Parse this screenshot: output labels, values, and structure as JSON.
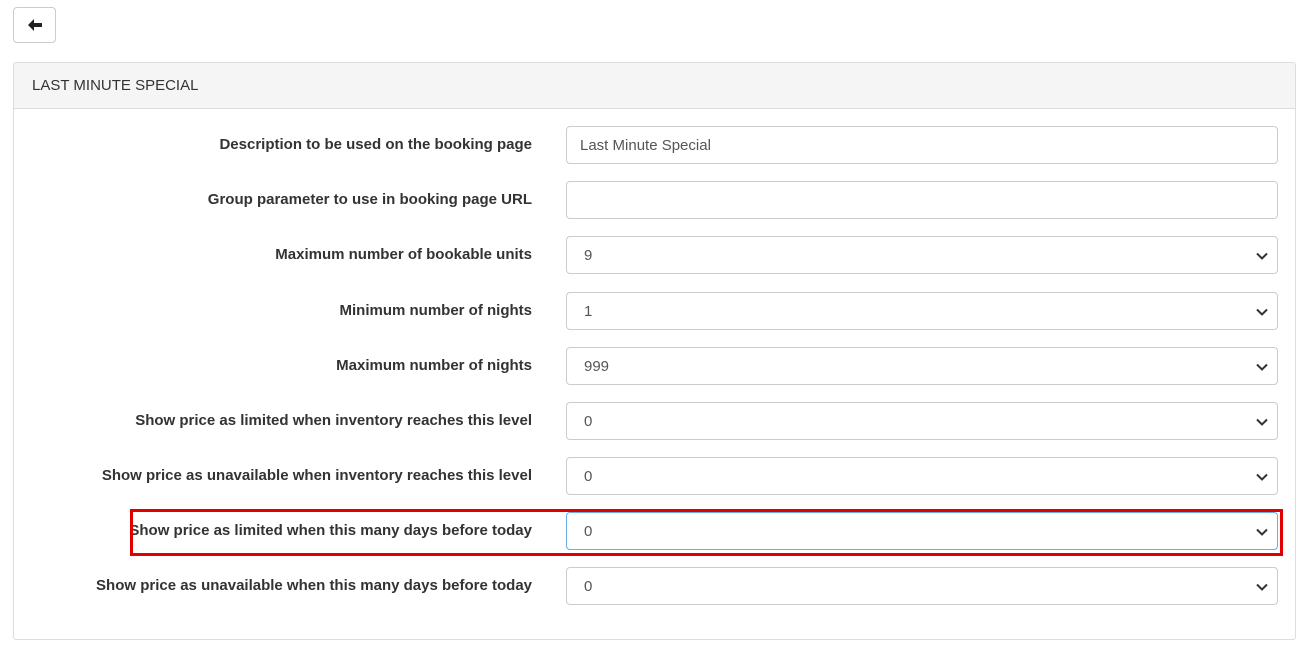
{
  "toolbar": {
    "back_icon": "arrow-left-icon"
  },
  "panel": {
    "title": "LAST MINUTE SPECIAL"
  },
  "fields": [
    {
      "label": "Description to be used on the booking page",
      "type": "text",
      "value": "Last Minute Special"
    },
    {
      "label": "Group parameter to use in booking page URL",
      "type": "text",
      "value": ""
    },
    {
      "label": "Maximum number of bookable units",
      "type": "select",
      "value": "9"
    },
    {
      "label": "Minimum number of nights",
      "type": "select",
      "value": "1"
    },
    {
      "label": "Maximum number of nights",
      "type": "select",
      "value": "999"
    },
    {
      "label": "Show price as limited when inventory reaches this level",
      "type": "select",
      "value": "0"
    },
    {
      "label": "Show price as unavailable when inventory reaches this level",
      "type": "select",
      "value": "0"
    },
    {
      "label": "Show price as limited when this many days before today",
      "type": "select",
      "value": "0",
      "highlighted": true
    },
    {
      "label": "Show price as unavailable when this many days before today",
      "type": "select",
      "value": "0"
    }
  ],
  "colors": {
    "highlight": "#e00000",
    "focus_border": "#66afe9",
    "panel_heading_bg": "#f5f5f5"
  }
}
